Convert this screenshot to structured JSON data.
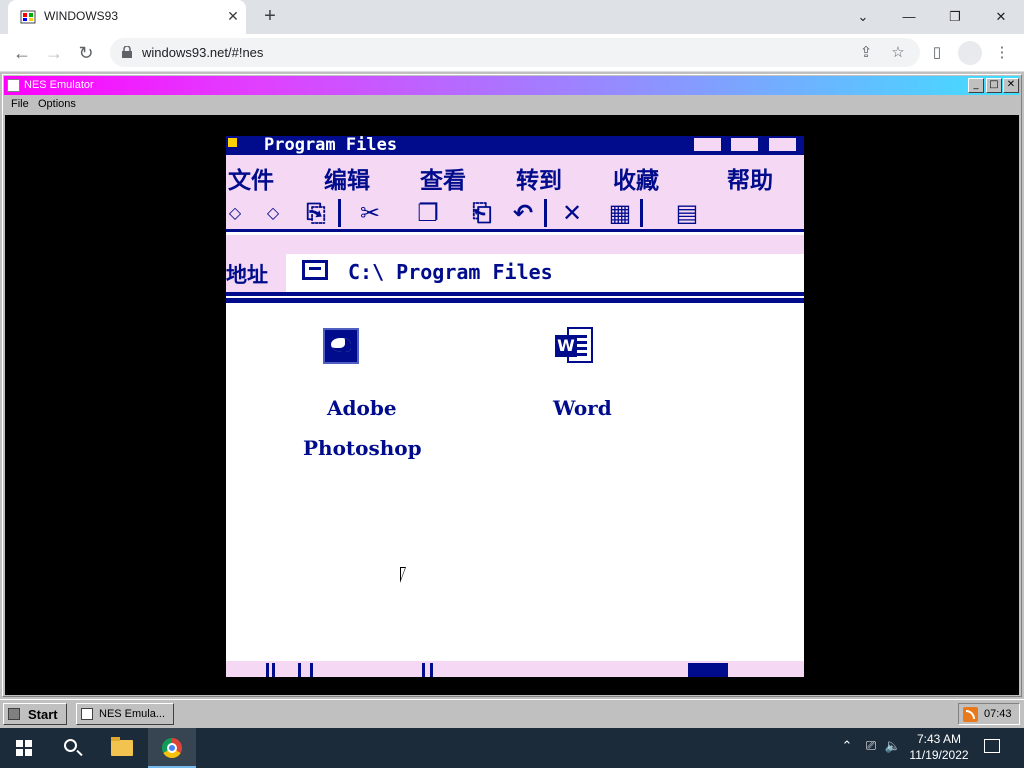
{
  "browser": {
    "tab_title": "WINDOWS93",
    "url": "windows93.net/#!nes",
    "icons": {
      "back": "arrow-left-icon",
      "forward": "arrow-right-icon",
      "reload": "reload-icon",
      "minimize": "minimize-icon",
      "restore": "restore-icon",
      "close": "close-icon"
    }
  },
  "nes_window": {
    "title": "NES Emulator",
    "menu": [
      "File",
      "Options"
    ],
    "gradient_start": "#ff00ff",
    "gradient_end": "#40e0ff"
  },
  "game": {
    "window_title": "Program Files",
    "menu": [
      "文件",
      "编辑",
      "查看",
      "转到",
      "收藏",
      "帮助"
    ],
    "address_label": "地址",
    "address_value": "C:\\ Program Files",
    "files": [
      {
        "line1": "Adobe",
        "line2": "Photoshop",
        "icon": "photoshop-icon"
      },
      {
        "line1": "Word",
        "icon": "word-document-icon"
      }
    ],
    "accent_color": "#000c8c",
    "panel_color": "#f4d8f4"
  },
  "w93_taskbar": {
    "start_label": "Start",
    "task_label": "NES Emula...",
    "clock": "07:43"
  },
  "win_taskbar": {
    "time": "7:43 AM",
    "date": "11/19/2022"
  }
}
